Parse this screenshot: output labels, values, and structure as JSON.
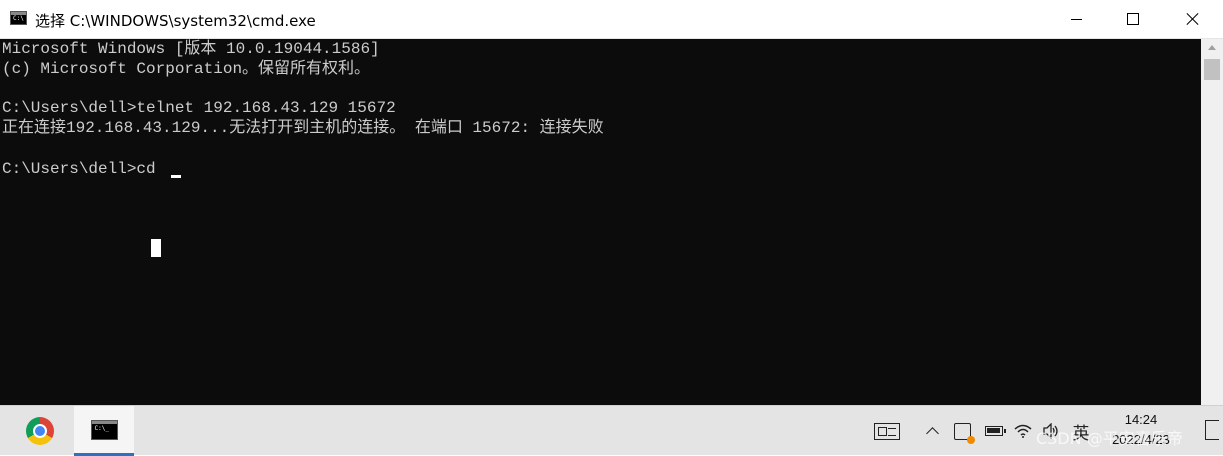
{
  "window": {
    "title": "选择 C:\\WINDOWS\\system32\\cmd.exe",
    "icon": "cmd-icon"
  },
  "console": {
    "lines": [
      "Microsoft Windows [版本 10.0.19044.1586]",
      "(c) Microsoft Corporation。保留所有权利。",
      "",
      "C:\\Users\\dell>telnet 192.168.43.129 15672",
      "正在连接192.168.43.129...无法打开到主机的连接。 在端口 15672: 连接失败",
      "",
      "C:\\Users\\dell>cd "
    ],
    "colors": {
      "background": "#0c0c0c",
      "text": "#cccccc"
    }
  },
  "taskbar": {
    "apps": [
      {
        "name": "chrome",
        "icon": "chrome-icon"
      },
      {
        "name": "cmd",
        "icon": "cmd-icon"
      }
    ],
    "tray": {
      "ime": "英",
      "time": "14:24",
      "date": "2022/4/23"
    },
    "watermark": "CSDN @平安喜乐帝",
    "accent": "#2b72c7"
  }
}
